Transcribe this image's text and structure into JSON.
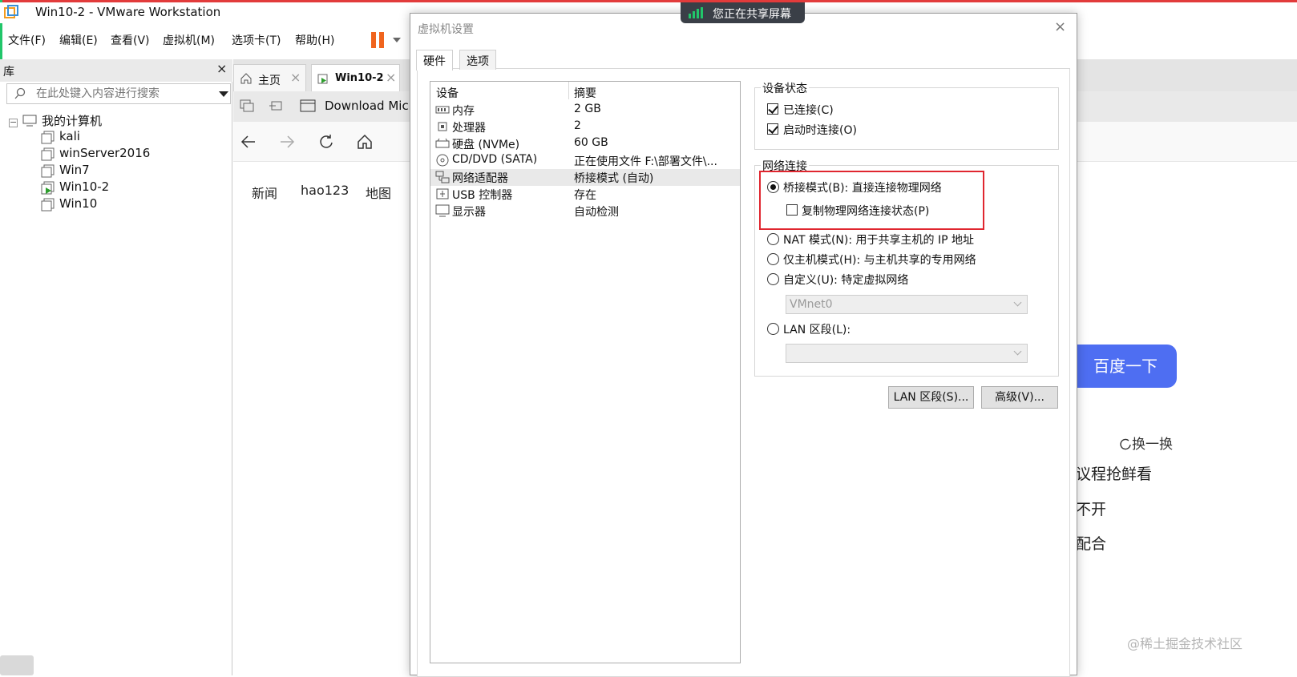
{
  "window": {
    "title": "Win10-2 - VMware Workstation",
    "menu": [
      "文件(F)",
      "编辑(E)",
      "查看(V)",
      "虚拟机(M)",
      "选项卡(T)",
      "帮助(H)"
    ]
  },
  "library": {
    "title": "库",
    "close": "×",
    "search_placeholder": "在此处键入内容进行搜索",
    "root": "我的计算机",
    "vms": [
      "kali",
      "winServer2016",
      "Win7",
      "Win10-2",
      "Win10"
    ],
    "running_vm": "Win10-2"
  },
  "tabs": [
    {
      "label": "主页",
      "active": false
    },
    {
      "label": "Win10-2",
      "active": true
    }
  ],
  "guest": {
    "download_tab": "Download Micr",
    "links": [
      "新闻",
      "hao123",
      "地图"
    ],
    "search_button": "百度一下",
    "refresh": "换一换",
    "hot": [
      "议程抢鲜看",
      "不开",
      "配合"
    ],
    "watermark": "@稀土掘金技术社区"
  },
  "share_banner": "您正在共享屏幕",
  "dialog": {
    "title": "虚拟机设置",
    "close": "×",
    "tabs": [
      "硬件",
      "选项"
    ],
    "device_header": "设备",
    "summary_header": "摘要",
    "devices": [
      {
        "name": "内存",
        "summary": "2 GB",
        "icon": "memory-icon"
      },
      {
        "name": "处理器",
        "summary": "2",
        "icon": "cpu-icon"
      },
      {
        "name": "硬盘 (NVMe)",
        "summary": "60 GB",
        "icon": "disk-icon"
      },
      {
        "name": "CD/DVD (SATA)",
        "summary": "正在使用文件 F:\\部署文件\\...",
        "icon": "cd-icon"
      },
      {
        "name": "网络适配器",
        "summary": "桥接模式 (自动)",
        "icon": "network-icon",
        "selected": true
      },
      {
        "name": "USB 控制器",
        "summary": "存在",
        "icon": "usb-icon"
      },
      {
        "name": "显示器",
        "summary": "自动检测",
        "icon": "monitor-icon"
      }
    ],
    "device_status": {
      "legend": "设备状态",
      "connected": "已连接(C)",
      "connect_on_power": "启动时连接(O)"
    },
    "network": {
      "legend": "网络连接",
      "bridged": "桥接模式(B): 直接连接物理网络",
      "replicate": "复制物理网络连接状态(P)",
      "nat": "NAT 模式(N): 用于共享主机的 IP 地址",
      "host_only": "仅主机模式(H): 与主机共享的专用网络",
      "custom": "自定义(U): 特定虚拟网络",
      "custom_value": "VMnet0",
      "lan": "LAN 区段(L):",
      "lan_value": "",
      "selected": "bridged"
    },
    "buttons": {
      "lan_segments": "LAN 区段(S)...",
      "advanced": "高级(V)..."
    }
  },
  "colors": {
    "accent_red": "#e0262f",
    "baidu_blue": "#4e6ef2",
    "pause_orange": "#f0641e",
    "share_green": "#21c66a"
  }
}
